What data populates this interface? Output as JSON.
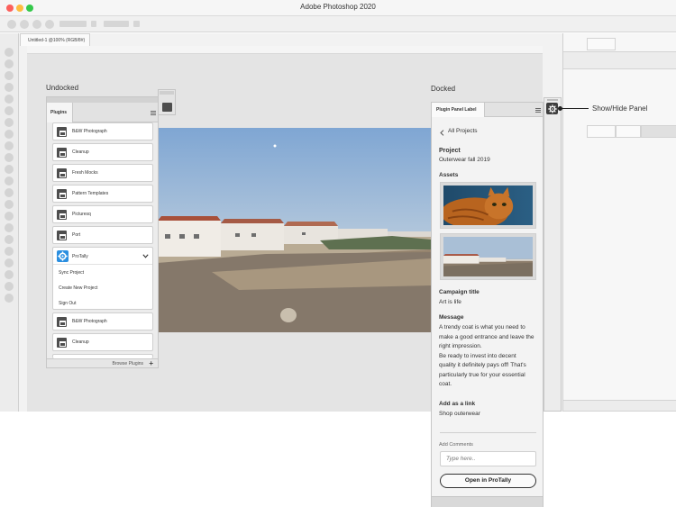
{
  "app": {
    "title": "Adobe Photoshop 2020"
  },
  "document": {
    "tab_label": "Untitled-1 @100% (RGB/8#)"
  },
  "labels": {
    "undocked": "Undocked",
    "docked": "Docked",
    "show_hide": "Show/Hide Panel"
  },
  "undocked_panel": {
    "tab_label": "Plugins",
    "items": [
      "B&W Photograph",
      "Cleanup",
      "Fresh Mocks",
      "Pattern Templates",
      "Picturesq",
      "Port"
    ],
    "expanded_item": {
      "label": "ProTally",
      "actions": [
        "Sync Project",
        "Create New Project",
        "Sign Out"
      ]
    },
    "items_after": [
      "B&W Photograph",
      "Cleanup"
    ],
    "footer_label": "Browse Plugins",
    "footer_plus": "+"
  },
  "docked_panel": {
    "tab_label": "Plugin Panel Label",
    "back_label": "All Projects",
    "project_heading": "Project",
    "project_name": "Outerwear fall 2019",
    "assets_heading": "Assets",
    "campaign_heading": "Campaign title",
    "campaign_value": "Art is life",
    "message_heading": "Message",
    "message_lines": [
      "A trendy coat is what you need to",
      "make a good entrance and leave the",
      "right impression.",
      "Be ready to invest into decent",
      "quality it definitely pays off! That's",
      "particularly true for your essential",
      "coat."
    ],
    "link_heading": "Add as a link",
    "link_value": "Shop outerwear",
    "comments_label": "Add Comments",
    "comments_placeholder": "Type here..",
    "open_button": "Open in ProTally"
  },
  "colors": {
    "traffic_red": "#fc605c",
    "traffic_yellow": "#fdbc40",
    "traffic_green": "#34c84a",
    "protally_blue": "#2b8fe0"
  },
  "icons": {
    "plugin_item": "camera-icon",
    "protally": "gear-icon",
    "gear_button": "gear-icon",
    "menu": "hamburger-icon",
    "back": "chevron-left-icon",
    "expand": "chevron-down-icon"
  }
}
